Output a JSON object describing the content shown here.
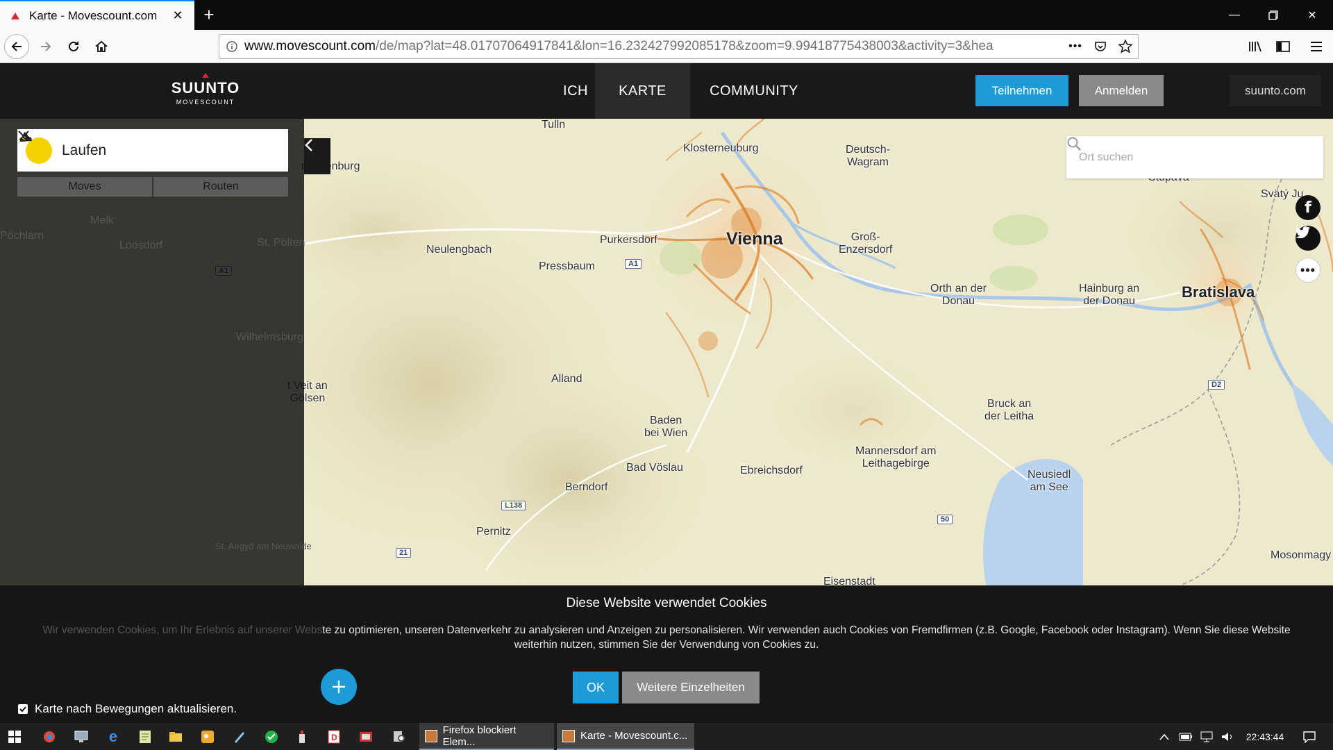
{
  "browser": {
    "tab_title": "Karte - Movescount.com",
    "url_domain": "www.movescount.com",
    "url_path": "/de/map?lat=48.01707064917841&lon=16.232427992085178&zoom=9.99418775438003&activity=3&hea",
    "more_label": "•••"
  },
  "site": {
    "logo_brand": "SUUNTO",
    "logo_sub": "MOVESCOUNT",
    "nav": [
      {
        "label": "ICH"
      },
      {
        "label": "KARTE"
      },
      {
        "label": "COMMUNITY"
      }
    ],
    "join_label": "Teilnehmen",
    "login_label": "Anmelden",
    "suunto_link": "suunto.com"
  },
  "panel": {
    "activity": "Laufen",
    "tabs": [
      "Moves",
      "Routen"
    ],
    "background_labels": [
      "Pöchlarn",
      "Melk",
      "Loosdorf",
      "St. Pölten",
      "Wilhelmsburg",
      "Sankt Veit an der Gölsen",
      "St. Aegyd am Neuwalde"
    ]
  },
  "search": {
    "placeholder": "Ort suchen"
  },
  "map": {
    "labels": {
      "tulln": "Tulln",
      "herzogenburg": "nzogenburg",
      "klosterneuburg": "Klosterneuburg",
      "deutsch_wagram": "Deutsch-\nWagram",
      "stupava": "Stupava",
      "svaty_jur": "Svätý Ju",
      "neulengbach": "Neulengbach",
      "purkersdorf": "Purkersdorf",
      "vienna": "Vienna",
      "gross_enzersdorf": "Groß-\nEnzersdorf",
      "pressbaum": "Pressbaum",
      "orth": "Orth an der\nDonau",
      "hainburg": "Hainburg an\nder Donau",
      "bratislava": "Bratislava",
      "alland": "Alland",
      "sankt_veit_right": "t Veit an\nGölsen",
      "bruck": "Bruck an\nder Leitha",
      "baden": "Baden\nbei Wien",
      "mannersdorf": "Mannersdorf am\nLeithagebirge",
      "bad_voeslau": "Bad Vöslau",
      "ebreichsdorf": "Ebreichsdorf",
      "neusiedl": "Neusiedl\nam See",
      "berndorf": "Berndorf",
      "pernitz": "Pernitz",
      "mosonmagy": "Mosonmagy",
      "eisenstadt": "Eisenstadt"
    },
    "roads": [
      "A1",
      "A1",
      "L138",
      "21",
      "50",
      "D2"
    ]
  },
  "cookie": {
    "title": "Diese Website verwendet Cookies",
    "text_dim": "Wir verwenden Cookies, um Ihr Erlebnis auf unserer Webs",
    "text": "te zu optimieren, unseren Datenverkehr zu analysieren und Anzeigen zu personalisieren. Wir verwenden auch Cookies von Fremdfirmen (z.B. Google, Facebook oder Instagram). Wenn Sie diese Website weiterhin nutzen, stimmen Sie der Verwendung von Cookies zu.",
    "ok_label": "OK",
    "more_label": "Weitere Einzelheiten",
    "update_label": "Karte nach Bewegungen aktualisieren."
  },
  "taskbar": {
    "tasks": [
      {
        "label": "Firefox blockiert Elem..."
      },
      {
        "label": "Karte - Movescount.c..."
      }
    ],
    "clock": "22:43:44"
  },
  "colors": {
    "accent": "#1e9ad6",
    "header_bg": "#191919",
    "heat": "#d9781a",
    "activity_icon": "#f2d200"
  }
}
